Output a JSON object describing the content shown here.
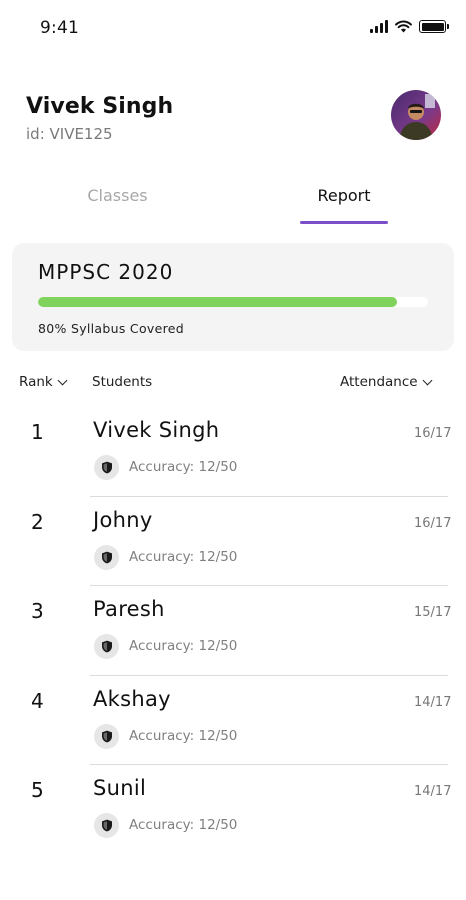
{
  "status_bar": {
    "time": "9:41"
  },
  "profile": {
    "name": "Vivek Singh",
    "id_label": "id: VIVE125"
  },
  "tabs": [
    {
      "label": "Classes",
      "active": false
    },
    {
      "label": "Report",
      "active": true
    }
  ],
  "course": {
    "title": "MPPSC 2020",
    "progress_percent": 92,
    "progress_label": "80% Syllabus Covered"
  },
  "table_headers": {
    "rank": "Rank",
    "students": "Students",
    "attendance": "Attendance"
  },
  "students": [
    {
      "rank": "1",
      "name": "Vivek Singh",
      "accuracy": "Accuracy: 12/50",
      "attendance": "16/17"
    },
    {
      "rank": "2",
      "name": "Johny",
      "accuracy": "Accuracy: 12/50",
      "attendance": "16/17"
    },
    {
      "rank": "3",
      "name": "Paresh",
      "accuracy": "Accuracy: 12/50",
      "attendance": "15/17"
    },
    {
      "rank": "4",
      "name": "Akshay",
      "accuracy": "Accuracy: 12/50",
      "attendance": "14/17"
    },
    {
      "rank": "5",
      "name": "Sunil",
      "accuracy": "Accuracy: 12/50",
      "attendance": "14/17"
    }
  ],
  "colors": {
    "accent": "#7b4fc9",
    "progress": "#7fd35b",
    "card_bg": "#f4f4f4"
  },
  "icons": {
    "accuracy": "shield-icon",
    "sort": "chevron-down-icon"
  }
}
